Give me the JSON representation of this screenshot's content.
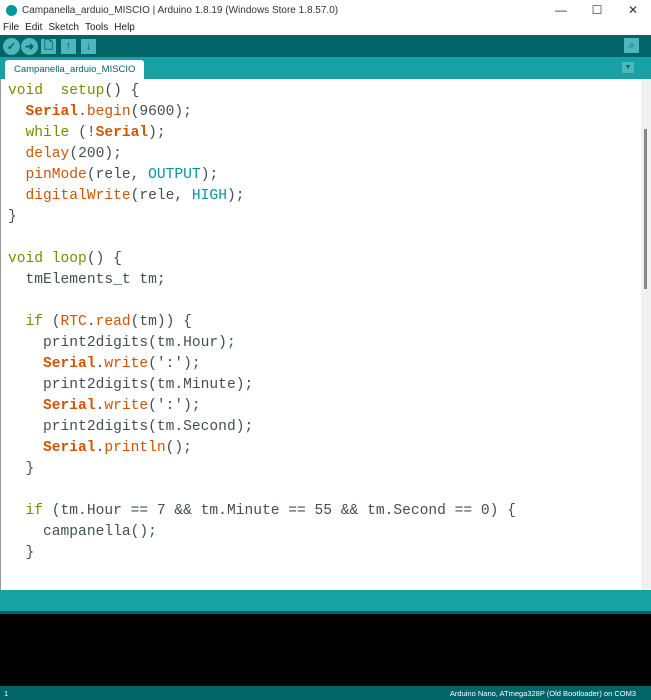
{
  "window": {
    "title": "Campanella_arduio_MISCIO | Arduino 1.8.19 (Windows Store 1.8.57.0)",
    "minimize": "—",
    "maximize": "☐",
    "close": "✕"
  },
  "menu": [
    "File",
    "Edit",
    "Sketch",
    "Tools",
    "Help"
  ],
  "toolbar": {
    "verify": "✓",
    "upload": "➜",
    "new": "🗋",
    "open": "↑",
    "save": "↓",
    "serial_monitor": "⌕"
  },
  "tab": {
    "name": "Campanella_arduio_MISCIO",
    "menu": "▼"
  },
  "code": [
    [
      [
        "kw",
        "void"
      ],
      [
        "",
        "  "
      ],
      [
        "kw",
        "setup"
      ],
      [
        "",
        "() {"
      ]
    ],
    [
      [
        "",
        "  "
      ],
      [
        "cls",
        "Serial"
      ],
      [
        "",
        "."
      ],
      [
        "fn",
        "begin"
      ],
      [
        "",
        "(9600);"
      ]
    ],
    [
      [
        "",
        "  "
      ],
      [
        "kw",
        "while"
      ],
      [
        "",
        " (!"
      ],
      [
        "cls",
        "Serial"
      ],
      [
        "",
        ");"
      ]
    ],
    [
      [
        "",
        "  "
      ],
      [
        "fn",
        "delay"
      ],
      [
        "",
        "(200);"
      ]
    ],
    [
      [
        "",
        "  "
      ],
      [
        "fn",
        "pinMode"
      ],
      [
        "",
        "(rele, "
      ],
      [
        "cst",
        "OUTPUT"
      ],
      [
        "",
        ");"
      ]
    ],
    [
      [
        "",
        "  "
      ],
      [
        "fn",
        "digitalWrite"
      ],
      [
        "",
        "(rele, "
      ],
      [
        "cst",
        "HIGH"
      ],
      [
        "",
        ");"
      ]
    ],
    [
      [
        "",
        "}"
      ]
    ],
    [
      [
        "",
        ""
      ]
    ],
    [
      [
        "kw",
        "void"
      ],
      [
        "",
        ""
      ],
      [
        "kw",
        " loop"
      ],
      [
        "",
        "() {"
      ]
    ],
    [
      [
        "",
        "  tmElements_t tm;"
      ]
    ],
    [
      [
        "",
        ""
      ]
    ],
    [
      [
        "",
        "  "
      ],
      [
        "kw",
        "if"
      ],
      [
        "",
        " ("
      ],
      [
        "fn",
        "RTC"
      ],
      [
        "",
        "."
      ],
      [
        "fn",
        "read"
      ],
      [
        "",
        "(tm)) {"
      ]
    ],
    [
      [
        "",
        "    print2digits(tm.Hour);"
      ]
    ],
    [
      [
        "",
        "    "
      ],
      [
        "cls",
        "Serial"
      ],
      [
        "",
        "."
      ],
      [
        "fn",
        "write"
      ],
      [
        "",
        "(':');"
      ]
    ],
    [
      [
        "",
        "    print2digits(tm.Minute);"
      ]
    ],
    [
      [
        "",
        "    "
      ],
      [
        "cls",
        "Serial"
      ],
      [
        "",
        "."
      ],
      [
        "fn",
        "write"
      ],
      [
        "",
        "(':');"
      ]
    ],
    [
      [
        "",
        "    print2digits(tm.Second);"
      ]
    ],
    [
      [
        "",
        "    "
      ],
      [
        "cls",
        "Serial"
      ],
      [
        "",
        "."
      ],
      [
        "fn",
        "println"
      ],
      [
        "",
        "();"
      ]
    ],
    [
      [
        "",
        "  }"
      ]
    ],
    [
      [
        "",
        ""
      ]
    ],
    [
      [
        "",
        "  "
      ],
      [
        "kw",
        "if"
      ],
      [
        "",
        " (tm.Hour == 7 && tm.Minute == 55 && tm.Second == 0) {"
      ]
    ],
    [
      [
        "",
        "    campanella();"
      ]
    ],
    [
      [
        "",
        "  }"
      ]
    ]
  ],
  "status": {
    "line": "1",
    "board": "Arduino Nano, ATmega328P (Old Bootloader) on COM3"
  }
}
